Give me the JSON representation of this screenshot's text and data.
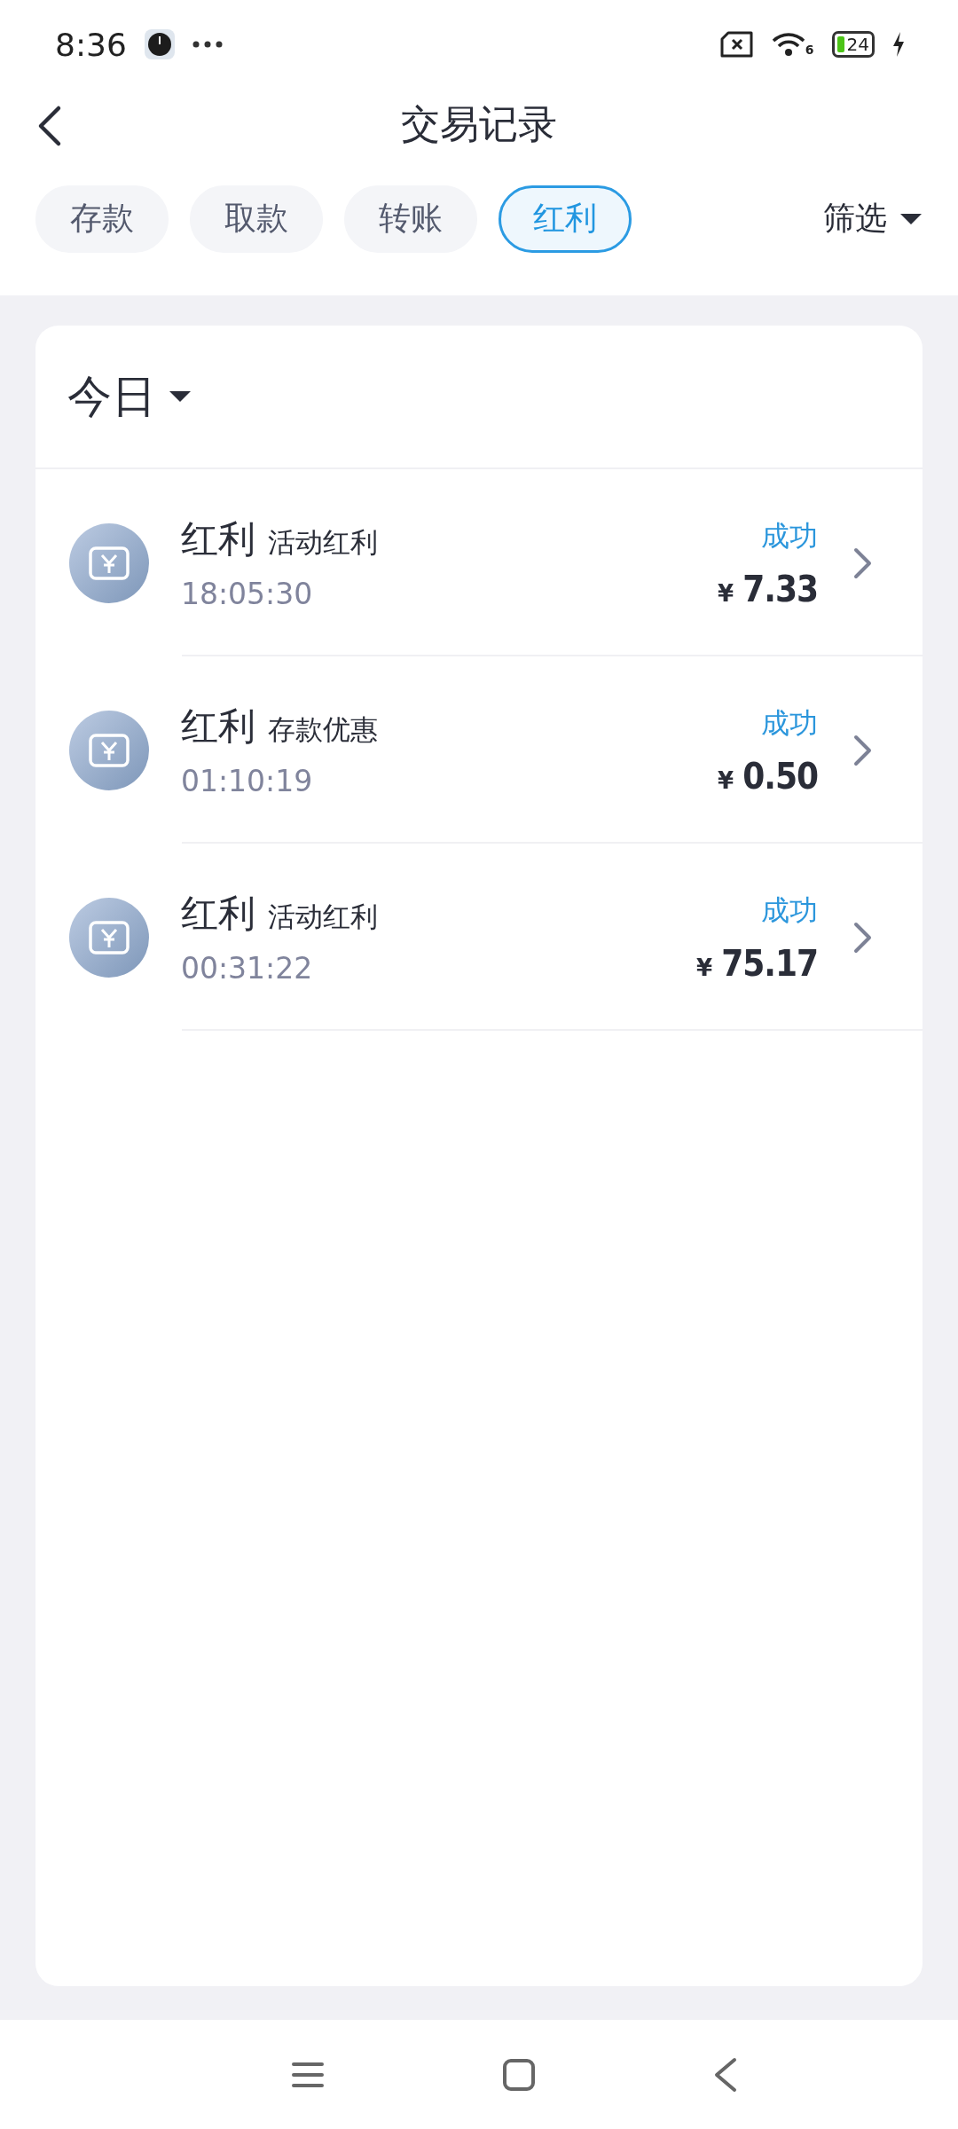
{
  "status_bar": {
    "time": "8:36",
    "battery": "24",
    "wifi_badge": "6"
  },
  "header": {
    "title": "交易记录"
  },
  "tabs": [
    {
      "label": "存款",
      "selected": false
    },
    {
      "label": "取款",
      "selected": false
    },
    {
      "label": "转账",
      "selected": false
    },
    {
      "label": "红利",
      "selected": true
    }
  ],
  "filter": {
    "label": "筛选"
  },
  "section": {
    "label": "今日"
  },
  "records": [
    {
      "type": "红利",
      "subtype": "活动红利",
      "time": "18:05:30",
      "status": "成功",
      "currency": "¥",
      "amount": "7.33"
    },
    {
      "type": "红利",
      "subtype": "存款优惠",
      "time": "01:10:19",
      "status": "成功",
      "currency": "¥",
      "amount": "0.50"
    },
    {
      "type": "红利",
      "subtype": "活动红利",
      "time": "00:31:22",
      "status": "成功",
      "currency": "¥",
      "amount": "75.17"
    }
  ]
}
